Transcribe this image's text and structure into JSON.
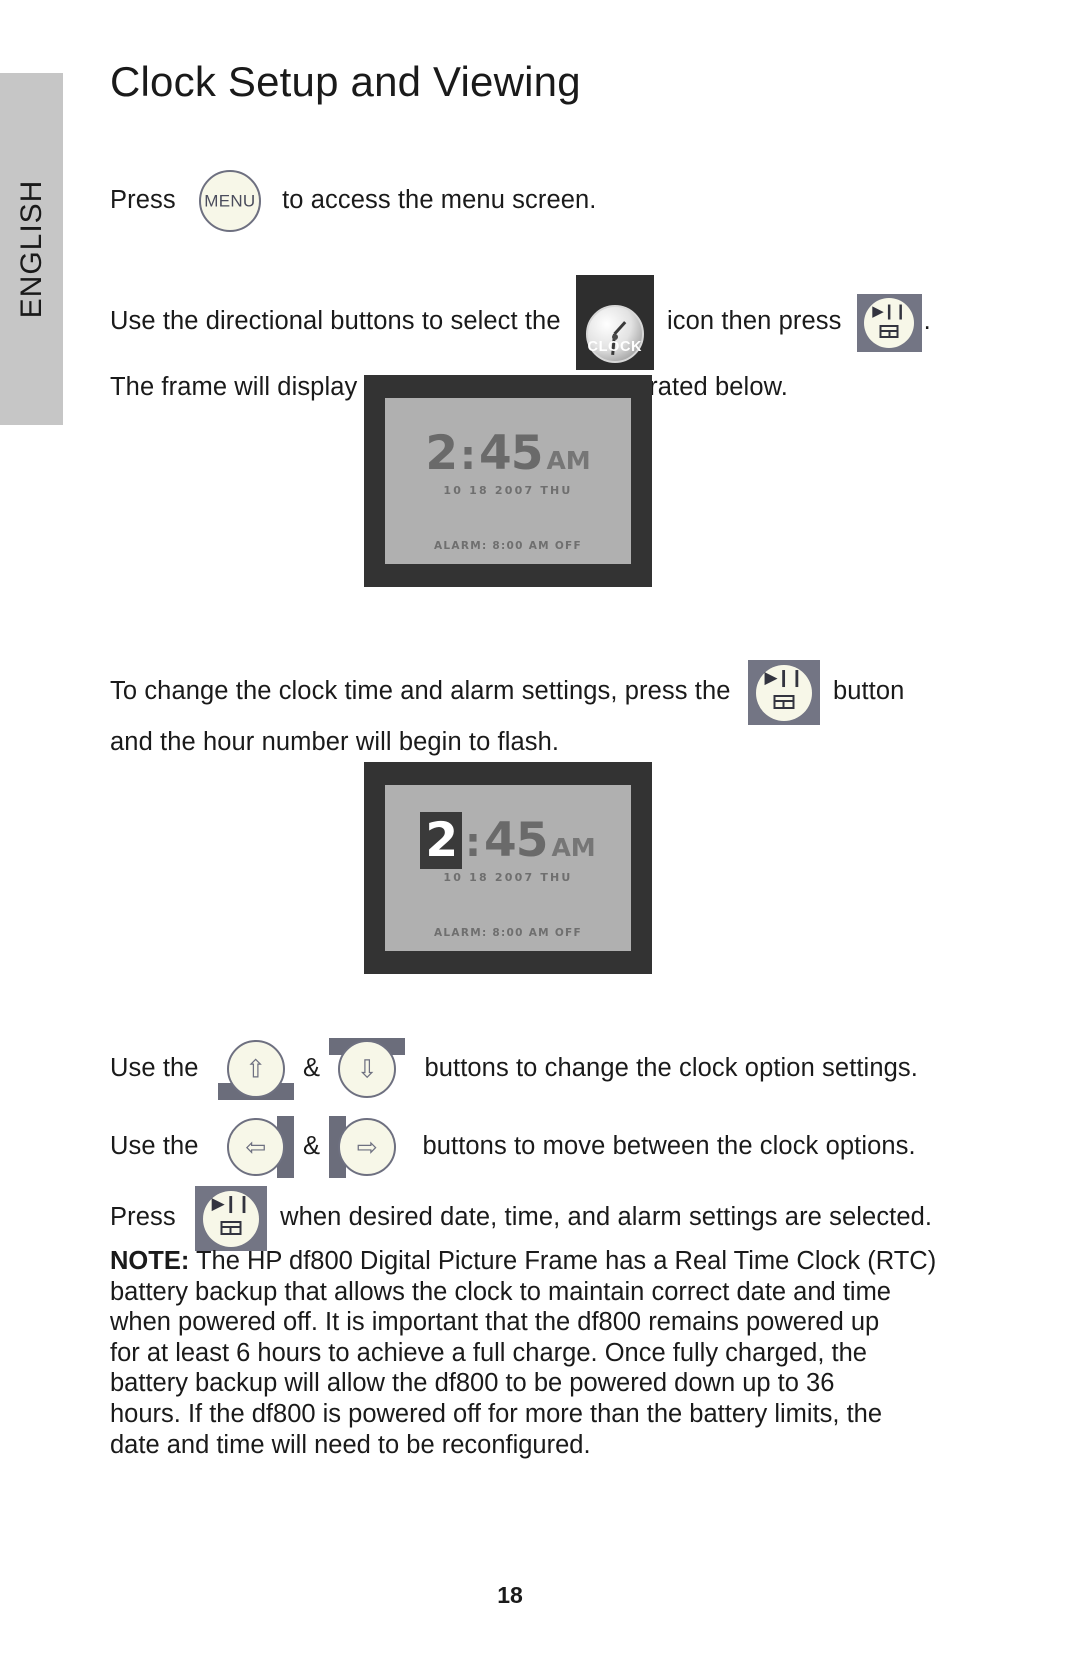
{
  "sidebar": {
    "language": "ENGLISH"
  },
  "page": {
    "title": "Clock Setup and Viewing",
    "number": "18"
  },
  "icons": {
    "menu_label": "MENU",
    "clock_tile_label": "CLOCK",
    "play_glyph": "▶❙❙",
    "arrow_up": "⇧",
    "arrow_down": "⇩",
    "arrow_left": "⇦",
    "arrow_right": "⇨"
  },
  "steps": {
    "press_menu": {
      "pre": "Press",
      "post": "to access the menu screen."
    },
    "select_clock": {
      "pre": "Use the directional buttons to select the",
      "mid": "icon then press",
      "post": ".",
      "line2": "The frame will display the Clock screen as illustrated below."
    },
    "change_time": {
      "pre": "To change the clock time and alarm settings, press the",
      "post": "button",
      "line2": "and the hour number will begin to flash."
    },
    "updown": {
      "pre": "Use the",
      "amp": "&",
      "post": "buttons to change the clock option settings."
    },
    "leftright": {
      "pre": "Use the",
      "amp": "&",
      "post": "buttons to move between the clock options."
    },
    "confirm": {
      "pre": "Press",
      "post": "when desired date, time, and alarm settings are selected."
    }
  },
  "clock_screen_1": {
    "hour": "2",
    "colon": ":",
    "minute": "45",
    "ampm": "AM",
    "date": "10 18 2007 THU",
    "alarm": "ALARM: 8:00 AM OFF"
  },
  "clock_screen_2": {
    "hour": "2",
    "colon": ":",
    "minute": "45",
    "ampm": "AM",
    "date": "10 18 2007 THU",
    "alarm": "ALARM: 8:00 AM OFF"
  },
  "note": {
    "label": "NOTE:",
    "lines": [
      " The HP df800 Digital Picture Frame has a Real Time Clock (RTC)",
      "battery backup that allows the clock to maintain correct date and time",
      "when powered off.  It is important that the df800 remains powered up",
      "for at least 6 hours to achieve a full charge.  Once fully charged, the",
      "battery backup will allow the df800 to be powered down up to 36",
      "hours.  If the df800 is powered off for more than the battery limits, the",
      "date and time will need to be reconfigured."
    ]
  },
  "colors": {
    "sidebar_gray": "#c6c6c6",
    "frame_dark": "#333333",
    "screen_gray": "#b0b0b0",
    "button_gray": "#737584",
    "button_cream": "#f7f7e8"
  }
}
